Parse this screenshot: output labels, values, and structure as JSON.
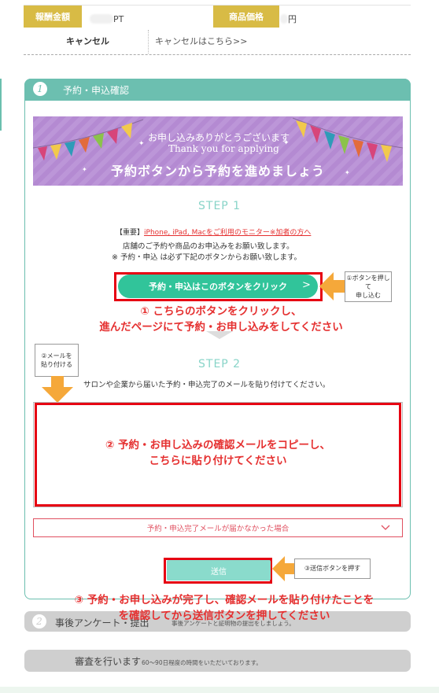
{
  "info": {
    "reward_label": "報酬金額",
    "reward_value_suffix": "PT",
    "price_label": "商品価格",
    "price_value_suffix": "円",
    "cancel_label": "キャンセル",
    "cancel_link": "キャンセルはこちら>>"
  },
  "step_card": {
    "number": "1",
    "title": "予約・申込確認"
  },
  "banner": {
    "line1": "お申し込みありがとうございます",
    "line2": "Thank you for applying",
    "line3": "予約ボタンから予約を進めましょう"
  },
  "step1": {
    "label": "STEP 1",
    "note_tag": "【重要】",
    "note_link": "iPhone, iPad, Macをご利用のモニター※加者の方へ",
    "desc1": "店舗のご予約や商品のお申込みをお願い致します。",
    "desc2": "※ 予約・申込 は必ず下記のボタンからお願い致します。",
    "button": "予約・申込はこのボタンをクリック",
    "button_chevron": ">",
    "callout": "①ボタンを押して\n申し込む",
    "instruction": "① こちらのボタンをクリックし、\n進んだページにて予約・お申し込みをしてください"
  },
  "step2": {
    "label": "STEP 2",
    "callout": "②メールを\n貼り付ける",
    "desc": "サロンや企業から届いた予約・申込完了のメールを貼り付けてください。",
    "instruction": "② 予約・お申し込みの確認メールをコピーし、\nこちらに貼り付けてください",
    "dropdown": "予約・申込完了メールが届かなかった場合"
  },
  "submit": {
    "button": "送信",
    "callout": "③送信ボタンを押す",
    "instruction": "③ 予約・お申し込みが完了し、確認メールを貼り付けたことを\nを確認してから送信ボタンを押してください"
  },
  "step2_pill": {
    "number": "2",
    "title": "事後アンケート・提出",
    "sub": "事後アンケートと証明物の提出をしましょう。"
  },
  "review_pill": {
    "title": "審査を行います",
    "sub": "60〜90日程度の時間をいただいております。"
  },
  "colors": {
    "gold": "#d8bb45",
    "teal": "#6cbfb0",
    "button_green": "#31c49a",
    "highlight_red": "#e60012",
    "arrow_orange": "#f5a83a",
    "banner_purple": "#b48ad2"
  }
}
